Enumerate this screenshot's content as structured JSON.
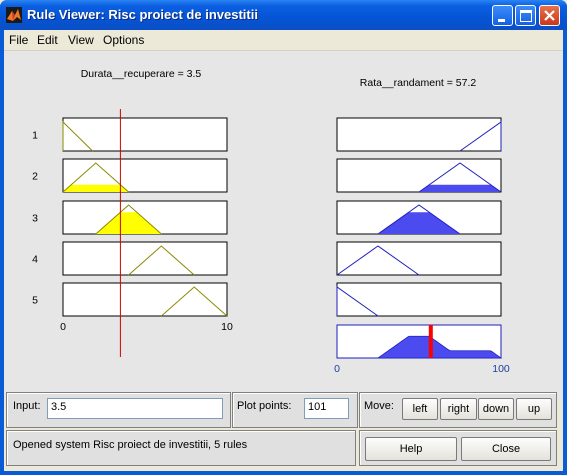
{
  "window": {
    "title": "Rule Viewer: Risc proiect de investitii"
  },
  "menu": {
    "items": [
      "File",
      "Edit",
      "View",
      "Options"
    ]
  },
  "input_var": {
    "label": "Durata__recuperare = 3.5",
    "value": 3.5,
    "range": [
      0,
      10
    ],
    "tick_min": "0",
    "tick_max": "10",
    "color": "#ffff00"
  },
  "output_var": {
    "label": "Rata__randament = 57.2",
    "value": 57.2,
    "range": [
      0,
      100
    ],
    "tick_min": "0",
    "tick_max": "100",
    "color": "#4b4bf0"
  },
  "rules": [
    {
      "number": "1",
      "in_mf": [
        0,
        0,
        1.8
      ],
      "out_mf": [
        75,
        100,
        100
      ]
    },
    {
      "number": "2",
      "in_mf": [
        0,
        2,
        4
      ],
      "out_mf": [
        50,
        75,
        100
      ]
    },
    {
      "number": "3",
      "in_mf": [
        2,
        4,
        6
      ],
      "out_mf": [
        25,
        50,
        75
      ]
    },
    {
      "number": "4",
      "in_mf": [
        4,
        6,
        8
      ],
      "out_mf": [
        0,
        25,
        50
      ]
    },
    {
      "number": "5",
      "in_mf": [
        6,
        8,
        10
      ],
      "out_mf": [
        0,
        0,
        25
      ]
    }
  ],
  "aggregate_color": "#4b4bf0",
  "controls": {
    "input_label": "Input:",
    "input_value": "3.5",
    "plot_points_label": "Plot points:",
    "plot_points_value": "101",
    "move_label": "Move:",
    "move_buttons": [
      "left",
      "right",
      "down",
      "up"
    ],
    "help_label": "Help",
    "close_label": "Close"
  },
  "status": "Opened system Risc proiect de investitii, 5 rules"
}
